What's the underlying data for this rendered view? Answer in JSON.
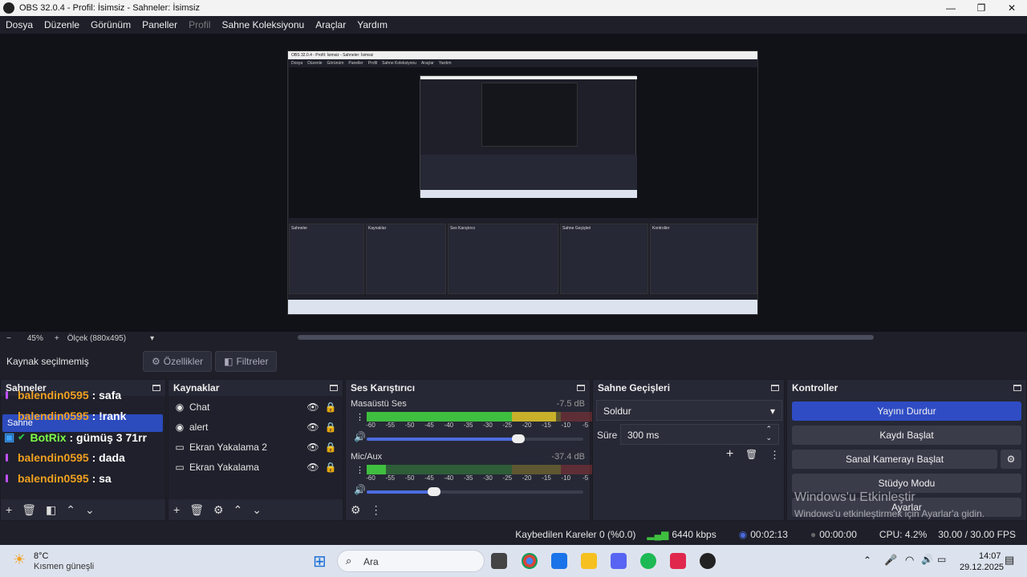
{
  "window": {
    "title": "OBS 32.0.4 - Profil: İsimsiz - Sahneler: İsimsiz",
    "minimize": "—",
    "maximize": "❐",
    "close": "✕"
  },
  "menu": [
    "Dosya",
    "Düzenle",
    "Görünüm",
    "Paneller",
    "Profil",
    "Sahne Koleksiyonu",
    "Araçlar",
    "Yardım"
  ],
  "preview_toolbar": {
    "zoom_minus": "−",
    "zoom": "45%",
    "zoom_plus": "+",
    "scale": "Ölçek (880x495)"
  },
  "context": {
    "no_selection": "Kaynak seçilmemiş",
    "properties": "Özellikler",
    "filters": "Filtreler"
  },
  "scenes": {
    "title": "Sahneler",
    "selected": "Sahne",
    "chat": [
      {
        "user": "balendin0595",
        "msg": ": safa"
      },
      {
        "user": "balendin0595",
        "msg": ": !rank"
      },
      {
        "user": "BotRix",
        "msg": ": gümüş 3 71rr"
      },
      {
        "user": "balendin0595",
        "msg": ": dada"
      },
      {
        "user": "balendin0595",
        "msg": ": sa"
      }
    ]
  },
  "sources": {
    "title": "Kaynaklar",
    "items": [
      "Chat",
      "alert",
      "Ekran Yakalama 2",
      "Ekran Yakalama"
    ]
  },
  "mixer": {
    "title": "Ses Karıştırıcı",
    "channels": [
      {
        "name": "Masaüstü Ses",
        "db": "-7.5 dB",
        "level": 0.78,
        "volume": 0.7
      },
      {
        "name": "Mic/Aux",
        "db": "-37.4 dB",
        "level": 0.08,
        "volume": 0.31
      }
    ],
    "ticks": [
      "-60",
      "-55",
      "-50",
      "-45",
      "-40",
      "-35",
      "-30",
      "-25",
      "-20",
      "-15",
      "-10",
      "-5",
      "0"
    ]
  },
  "transitions": {
    "title": "Sahne Geçişleri",
    "selected": "Soldur",
    "duration_label": "Süre",
    "duration": "300 ms"
  },
  "controls": {
    "title": "Kontroller",
    "stop_stream": "Yayını Durdur",
    "start_record": "Kaydı Başlat",
    "virtual_cam": "Sanal Kamerayı Başlat",
    "studio_mode": "Stüdyo Modu",
    "settings": "Ayarlar"
  },
  "activation": {
    "title": "Windows'u Etkinleştir",
    "subtitle": "Windows'u etkinleştirmek için Ayarlar'a gidin."
  },
  "status": {
    "dropped": "Kaybedilen Kareler 0 (%0.0)",
    "bitrate": "6440 kbps",
    "stream_time": "00:02:13",
    "record_time": "00:00:00",
    "cpu": "CPU: 4.2%",
    "fps": "30.00 / 30.00 FPS"
  },
  "taskbar": {
    "weather_temp": "8°C",
    "weather_desc": "Kısmen güneşli",
    "search": "Ara",
    "time": "14:07",
    "date": "29.12.2025"
  },
  "colors": {
    "accent": "#2f4cc4",
    "meter_green": "#3fbf3f",
    "meter_yellow": "#c8b02a",
    "meter_red": "#c83a3a"
  }
}
